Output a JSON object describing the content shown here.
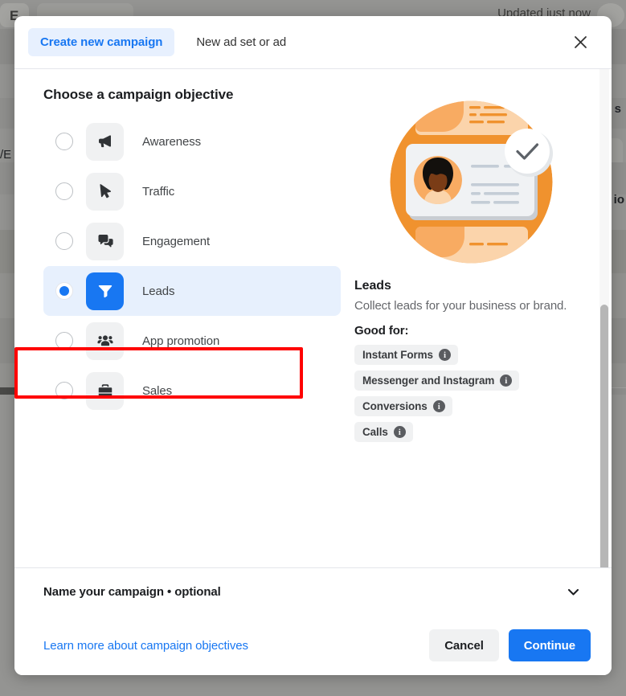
{
  "background": {
    "updated_text": "Updated just now",
    "left_fragment": "/E",
    "right_fragment_1": "s",
    "right_fragment_2": "io"
  },
  "modal": {
    "tabs": [
      {
        "label": "Create new campaign",
        "active": true,
        "name": "tab-create-new-campaign"
      },
      {
        "label": "New ad set or ad",
        "active": false,
        "name": "tab-new-ad-set-or-ad"
      }
    ],
    "close_icon": "close-icon",
    "section_title": "Choose a campaign objective",
    "objectives": [
      {
        "label": "Awareness",
        "icon": "megaphone-icon",
        "selected": false
      },
      {
        "label": "Traffic",
        "icon": "cursor-arrow-icon",
        "selected": false
      },
      {
        "label": "Engagement",
        "icon": "chat-bubbles-icon",
        "selected": false
      },
      {
        "label": "Leads",
        "icon": "funnel-icon",
        "selected": true
      },
      {
        "label": "App promotion",
        "icon": "people-group-icon",
        "selected": false
      },
      {
        "label": "Sales",
        "icon": "briefcase-icon",
        "selected": false
      }
    ],
    "detail": {
      "illustration": "id-card-with-checkmark-illustration",
      "title": "Leads",
      "description": "Collect leads for your business or brand.",
      "good_for_label": "Good for:",
      "chips": [
        {
          "label": "Instant Forms",
          "info": "i"
        },
        {
          "label": "Messenger and Instagram",
          "info": "i"
        },
        {
          "label": "Conversions",
          "info": "i"
        },
        {
          "label": "Calls",
          "info": "i"
        }
      ]
    },
    "name_section": {
      "label": "Name your campaign • optional",
      "chevron": "chevron-down-icon"
    },
    "footer": {
      "learn_more": "Learn more about campaign objectives",
      "cancel_label": "Cancel",
      "continue_label": "Continue"
    }
  },
  "colors": {
    "accent_blue": "#1877f2",
    "selected_row_bg": "#e7f0fd",
    "annotation_red": "#ff0000",
    "illustration_orange": "#f0922e",
    "chip_bg": "#f0f1f2"
  }
}
